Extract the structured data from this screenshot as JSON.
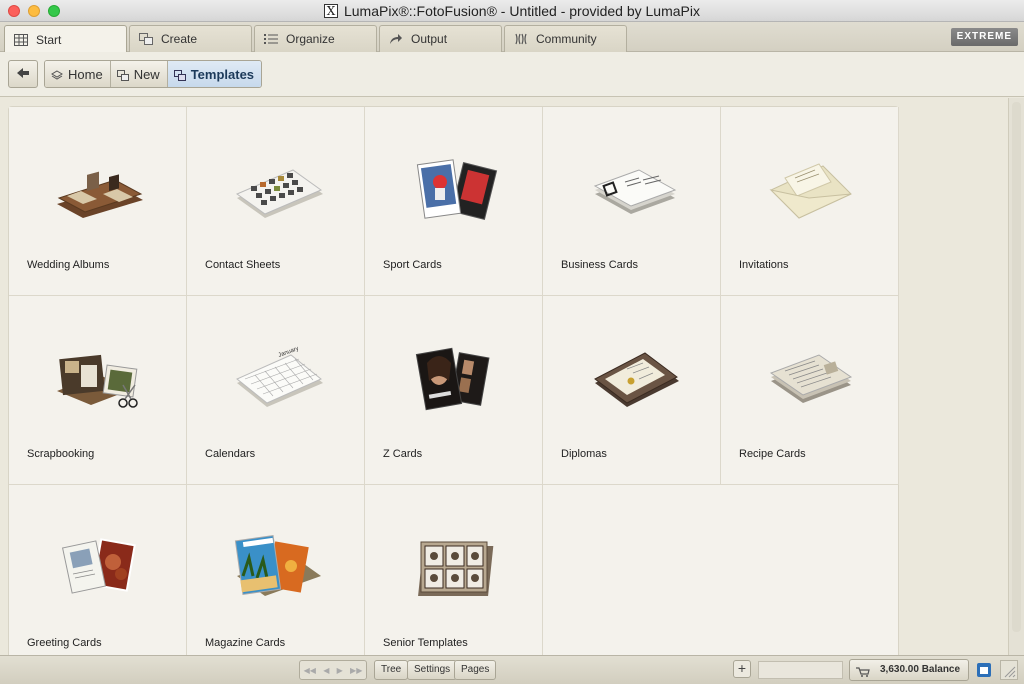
{
  "window": {
    "title": "LumaPix®::FotoFusion® - Untitled - provided by LumaPix"
  },
  "tabs": [
    {
      "label": "Start",
      "icon": "grid-icon",
      "active": true
    },
    {
      "label": "Create",
      "icon": "create-icon",
      "active": false
    },
    {
      "label": "Organize",
      "icon": "list-icon",
      "active": false
    },
    {
      "label": "Output",
      "icon": "output-arrow-icon",
      "active": false
    },
    {
      "label": "Community",
      "icon": "community-icon",
      "active": false
    }
  ],
  "edition_badge": "EXTREME",
  "breadcrumb": [
    {
      "label": "Home",
      "icon": "home-layers-icon"
    },
    {
      "label": "New",
      "icon": "new-icon"
    },
    {
      "label": "Templates",
      "icon": "templates-icon",
      "active": true
    }
  ],
  "templates": [
    {
      "label": "Wedding Albums",
      "icon": "wedding-album-icon"
    },
    {
      "label": "Contact Sheets",
      "icon": "contact-sheet-icon"
    },
    {
      "label": "Sport Cards",
      "icon": "sport-cards-icon"
    },
    {
      "label": "Business Cards",
      "icon": "business-cards-icon"
    },
    {
      "label": "Invitations",
      "icon": "invitation-envelope-icon"
    },
    {
      "label": "Scrapbooking",
      "icon": "scrapbook-icon"
    },
    {
      "label": "Calendars",
      "icon": "calendar-icon"
    },
    {
      "label": "Z Cards",
      "icon": "z-cards-icon"
    },
    {
      "label": "Diplomas",
      "icon": "diploma-icon"
    },
    {
      "label": "Recipe Cards",
      "icon": "recipe-cards-icon"
    },
    {
      "label": "Greeting Cards",
      "icon": "greeting-cards-icon"
    },
    {
      "label": "Magazine Cards",
      "icon": "magazine-cards-icon"
    },
    {
      "label": "Senior Templates",
      "icon": "senior-templates-icon"
    }
  ],
  "statusbar": {
    "buttons": [
      "Tree",
      "Settings",
      "Pages"
    ],
    "add_label": "+",
    "balance_label": "3,630.00 Balance"
  },
  "calendar_icon_text": "January"
}
